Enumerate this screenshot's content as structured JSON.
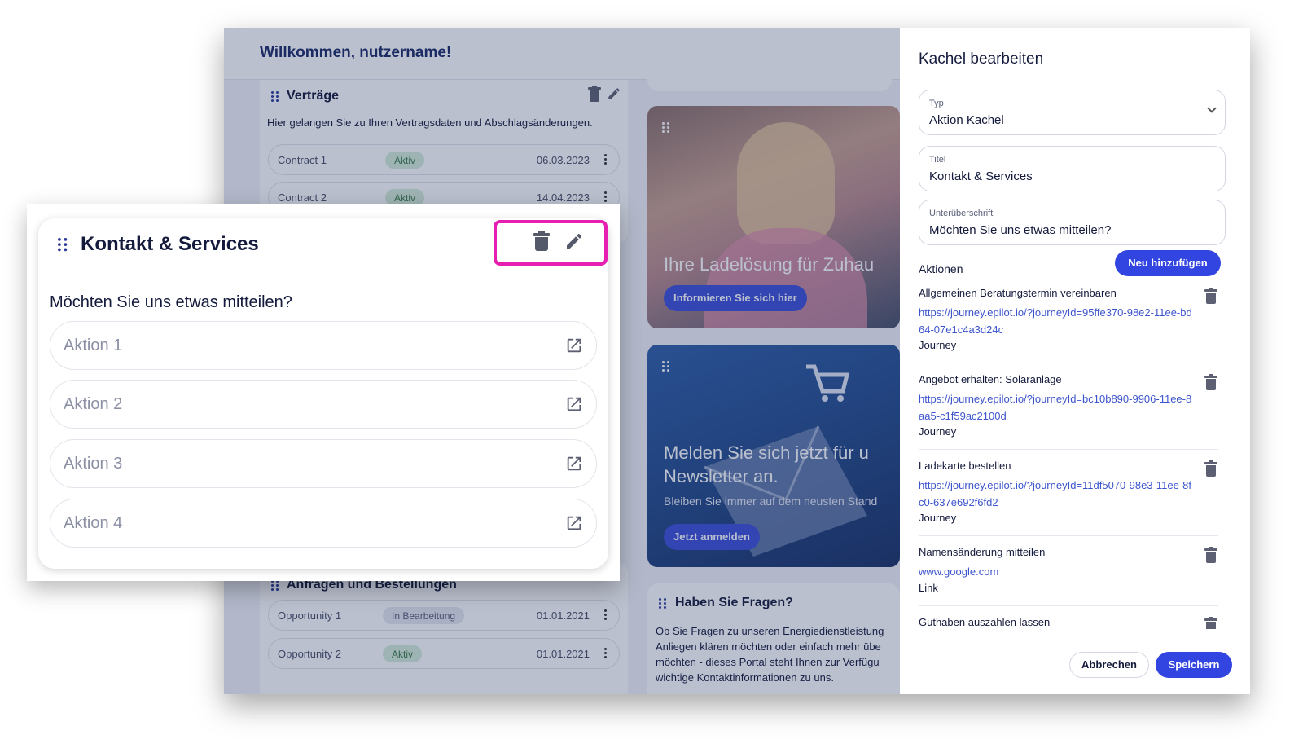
{
  "dashboard": {
    "welcome": "Willkommen, nutzername!",
    "vertraege": {
      "title": "Verträge",
      "description": "Hier gelangen Sie zu Ihren Vertragsdaten und Abschlagsänderungen.",
      "rows": [
        {
          "name": "Contract 1",
          "status": "Aktiv",
          "date": "06.03.2023"
        },
        {
          "name": "Contract 2",
          "status": "Aktiv",
          "date": "14.04.2023"
        }
      ]
    },
    "anfragen": {
      "title": "Anfragen und Bestellungen",
      "rows": [
        {
          "name": "Opportunity 1",
          "status": "In Bearbeitung",
          "date": "01.01.2021"
        },
        {
          "name": "Opportunity 2",
          "status": "Aktiv",
          "date": "01.01.2021"
        }
      ]
    },
    "promo1": {
      "title": "Ihre Ladelösung für Zuhau",
      "button": "Informieren Sie sich hier"
    },
    "promo2": {
      "title": "Melden Sie sich jetzt für u Newsletter an.",
      "subtitle": "Bleiben Sie immer auf dem neusten Stand",
      "button": "Jetzt anmelden"
    },
    "fragen": {
      "title": "Haben Sie Fragen?",
      "lines": [
        "Ob Sie Fragen zu unseren Energiedienstleistung",
        "Anliegen klären möchten oder einfach mehr übe",
        "möchten - dieses Portal steht Ihnen zur Verfügu",
        "wichtige Kontaktinformationen zu uns."
      ]
    }
  },
  "drawer": {
    "title": "Kachel bearbeiten",
    "typ": {
      "label": "Typ",
      "value": "Aktion Kachel"
    },
    "titel": {
      "label": "Titel",
      "value": "Kontakt & Services"
    },
    "untertitel": {
      "label": "Unterüberschrift",
      "value": "Möchten Sie uns etwas mitteilen?"
    },
    "aktionen_label": "Aktionen",
    "add_button": "Neu hinzufügen",
    "actions": [
      {
        "name": "Allgemeinen Beratungstermin vereinbaren",
        "url": "https://journey.epilot.io/?journeyId=95ffe370-98e2-11ee-bd64-07e1c4a3d24c",
        "type": "Journey"
      },
      {
        "name": "Angebot erhalten: Solaranlage",
        "url": "https://journey.epilot.io/?journeyId=bc10b890-9906-11ee-8aa5-c1f59ac2100d",
        "type": "Journey"
      },
      {
        "name": "Ladekarte bestellen",
        "url": "https://journey.epilot.io/?journeyId=11df5070-98e3-11ee-8fc0-637e692f6fd2",
        "type": "Journey"
      },
      {
        "name": "Namensänderung mitteilen",
        "url": "www.google.com",
        "type": "Link"
      },
      {
        "name": "Guthaben auszahlen lassen",
        "url": "",
        "type": ""
      }
    ],
    "cancel": "Abbrechen",
    "save": "Speichern"
  },
  "callout": {
    "title": "Kontakt & Services",
    "subtitle": "Möchten Sie uns etwas mitteilen?",
    "actions": [
      "Aktion 1",
      "Aktion 2",
      "Aktion 3",
      "Aktion 4"
    ],
    "highlight_color": "#e61fb0"
  },
  "colors": {
    "accent": "#3345e0",
    "title_text": "#141a3c",
    "link": "#3d55cc"
  }
}
